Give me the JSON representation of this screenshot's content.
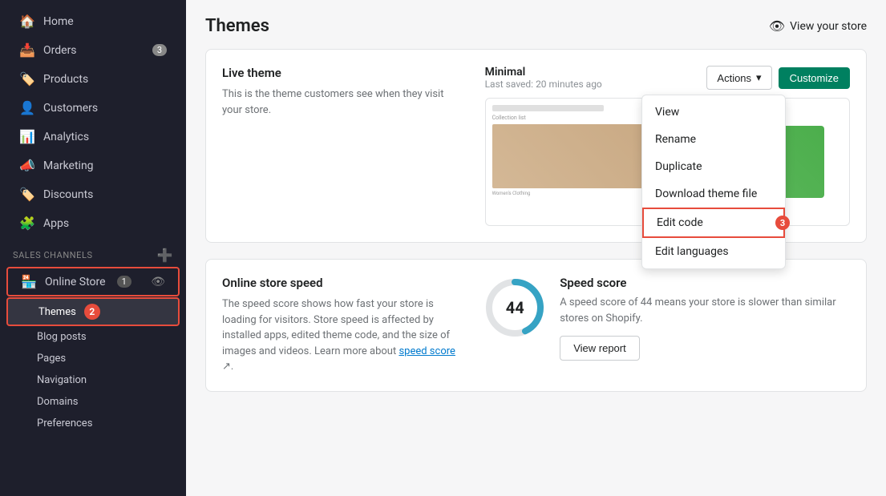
{
  "sidebar": {
    "nav_items": [
      {
        "id": "home",
        "label": "Home",
        "icon": "🏠",
        "badge": null
      },
      {
        "id": "orders",
        "label": "Orders",
        "icon": "📥",
        "badge": "3"
      },
      {
        "id": "products",
        "label": "Products",
        "icon": "🏷️",
        "badge": null
      },
      {
        "id": "customers",
        "label": "Customers",
        "icon": "👤",
        "badge": null
      },
      {
        "id": "analytics",
        "label": "Analytics",
        "icon": "📊",
        "badge": null
      },
      {
        "id": "marketing",
        "label": "Marketing",
        "icon": "📣",
        "badge": null
      },
      {
        "id": "discounts",
        "label": "Discounts",
        "icon": "🏷️",
        "badge": null
      },
      {
        "id": "apps",
        "label": "Apps",
        "icon": "🧩",
        "badge": null
      }
    ],
    "sales_channels_title": "SALES CHANNELS",
    "online_store_label": "Online Store",
    "online_store_badge": "1",
    "sub_items": [
      {
        "id": "themes",
        "label": "Themes",
        "active": true
      },
      {
        "id": "blog-posts",
        "label": "Blog posts",
        "active": false
      },
      {
        "id": "pages",
        "label": "Pages",
        "active": false
      },
      {
        "id": "navigation",
        "label": "Navigation",
        "active": false
      },
      {
        "id": "domains",
        "label": "Domains",
        "active": false
      },
      {
        "id": "preferences",
        "label": "Preferences",
        "active": false
      }
    ]
  },
  "header": {
    "title": "Themes",
    "view_store_label": "View your store"
  },
  "live_theme": {
    "section_title": "Live theme",
    "section_desc": "This is the theme customers see when they visit your store.",
    "theme_name": "Minimal",
    "last_saved": "Last saved: 20 minutes ago",
    "actions_label": "Actions",
    "customize_label": "Customize"
  },
  "dropdown": {
    "items": [
      {
        "id": "view",
        "label": "View"
      },
      {
        "id": "rename",
        "label": "Rename"
      },
      {
        "id": "duplicate",
        "label": "Duplicate"
      },
      {
        "id": "download",
        "label": "Download theme file"
      },
      {
        "id": "edit-code",
        "label": "Edit code",
        "highlighted": true,
        "step": "3"
      },
      {
        "id": "edit-languages",
        "label": "Edit languages"
      }
    ]
  },
  "speed": {
    "section_title": "Online store speed",
    "section_desc": "The speed score shows how fast your store is loading for visitors. Store speed is affected by installed apps, edited theme code, and the size of images and videos. Learn more about speed score.",
    "score_value": "44",
    "score_title": "Speed score",
    "score_desc": "A speed score of 44 means your store is slower than similar stores on Shopify.",
    "view_report_label": "View report"
  },
  "step_badges": {
    "online_store_step": "1",
    "themes_step": "2",
    "edit_code_step": "3"
  }
}
